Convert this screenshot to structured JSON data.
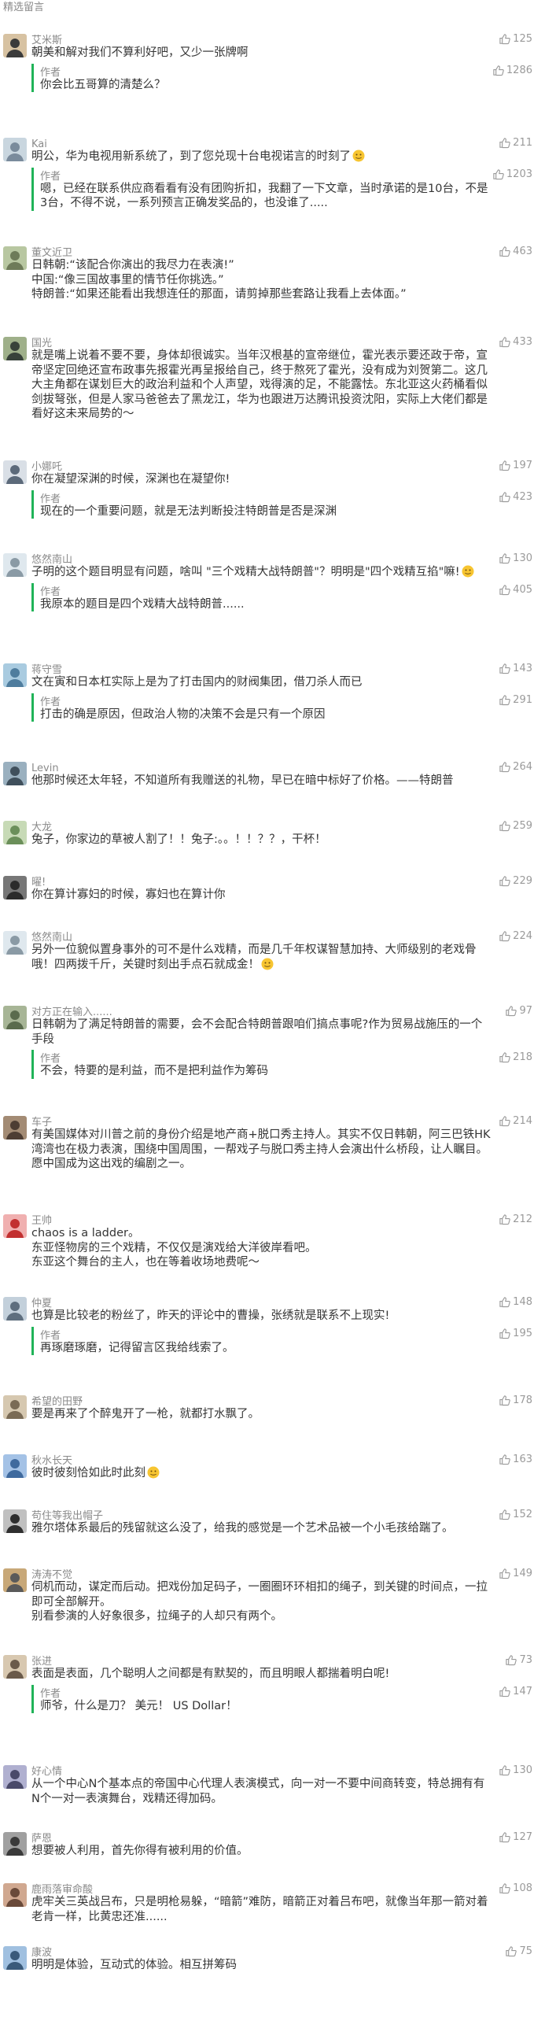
{
  "section_title": "精选留言",
  "author_label": "作者",
  "colors": {
    "accent": "#20b358",
    "meta": "#8a8a8a",
    "text": "#353535"
  },
  "comments": [
    {
      "nick": "艾米斯",
      "likes": "125",
      "text": "朝美和解对我们不算利好吧，又少一张牌啊",
      "reply": {
        "likes": "1286",
        "text": "你会比五哥算的清楚么？"
      }
    },
    {
      "nick": "Kai",
      "likes": "211",
      "text": "明公，华为电视用新系统了，到了您兑现十台电视诺言的时刻了",
      "reply": {
        "likes": "1203",
        "text": "嗯，已经在联系供应商看看有没有团购折扣，我翻了一下文章，当时承诺的是10台，不是3台，不得不说，一系列预言正确发奖品的，也没谁了....."
      }
    },
    {
      "nick": "董文近卫",
      "likes": "463",
      "text": "日韩朝:“该配合你演出的我尽力在表演!”\n中国:“像三国故事里的情节任你挑选。”\n特朗普:“如果还能看出我想连任的那面，请剪掉那些套路让我看上去体面。”"
    },
    {
      "nick": "国光",
      "likes": "433",
      "text": "就是嘴上说着不要不要，身体却很诚实。当年汉根基的宣帝继位，霍光表示要还政于帝，宣帝坚定回绝还宣布政事先报霍光再呈报给自己，终于熬死了霍光，没有成为刘贺第二。这几大主角都在谋划巨大的政治利益和个人声望，戏得演的足，不能露怯。东北亚这火药桶看似剑拔弩张，但是人家马爸爸去了黑龙江，华为也跟进万达腾讯投资沈阳，实际上大佬们都是看好这未来局势的～"
    },
    {
      "nick": "小娜吒",
      "likes": "197",
      "text": "你在凝望深渊的时候，深渊也在凝望你!",
      "reply": {
        "likes": "423",
        "text": "现在的一个重要问题，就是无法判断投注特朗普是否是深渊"
      }
    },
    {
      "nick": "悠然南山",
      "likes": "130",
      "text": "子明的这个题目明显有问题，啥叫 \"三个戏精大战特朗普\"？明明是\"四个戏精互掐\"嘛!",
      "reply": {
        "likes": "405",
        "text": "我原本的题目是四个戏精大战特朗普......"
      }
    },
    {
      "nick": "蒋守雪",
      "likes": "143",
      "text": "文在寅和日本杠实际上是为了打击国内的财阀集团，借刀杀人而已",
      "reply": {
        "likes": "291",
        "text": "打击的确是原因，但政治人物的决策不会是只有一个原因"
      }
    },
    {
      "nick": "Levin",
      "likes": "264",
      "text": "他那时候还太年轻，不知道所有我赠送的礼物，早已在暗中标好了价格。——特朗普"
    },
    {
      "nick": "大龙",
      "likes": "259",
      "text": "兔子，你家边的草被人割了！！兔子:。。！！？？，干杯！"
    },
    {
      "nick": "曜!",
      "likes": "229",
      "text": "你在算计寡妇的时候，寡妇也在算计你"
    },
    {
      "nick": "悠然南山",
      "likes": "224",
      "text": "另外一位貌似置身事外的可不是什么戏精，而是几千年权谋智慧加持、大师级别的老戏骨哦！四两拨千斤，关键时刻出手点石就成金！"
    },
    {
      "nick": "对方正在输入......",
      "likes": "97",
      "text": "日韩朝为了满足特朗普的需要，会不会配合特朗普跟咱们搞点事呢?作为贸易战施压的一个手段",
      "reply": {
        "likes": "218",
        "text": "不会，特要的是利益，而不是把利益作为筹码"
      }
    },
    {
      "nick": "车子",
      "likes": "214",
      "text": "有美国媒体对川普之前的身份介绍是地产商+脱口秀主持人。其实不仅日韩朝，阿三巴铁HK湾湾也在极力表演，围绕中国周围，一帮戏子与脱口秀主持人会演出什么桥段，让人瞩目。愿中国成为这出戏的编剧之一。"
    },
    {
      "nick": "王帅",
      "likes": "212",
      "text": "chaos is a ladder。\n东亚怪物房的三个戏精，不仅仅是演戏给大洋彼岸看吧。\n东亚这个舞台的主人，也在等着收场地费呢～"
    },
    {
      "nick": "仲夏",
      "likes": "148",
      "text": "也算是比较老的粉丝了，昨天的评论中的曹操，张绣就是联系不上现实!",
      "reply": {
        "likes": "195",
        "text": "再琢磨琢磨，记得留言区我给线索了。"
      }
    },
    {
      "nick": "希望的田野",
      "likes": "178",
      "text": "要是再来了个醉鬼开了一枪，就都打水飘了。"
    },
    {
      "nick": "秋水长天",
      "likes": "163",
      "text": "彼时彼刻恰如此时此刻"
    },
    {
      "nick": "苟住等我出帽子",
      "likes": "152",
      "text": "雅尔塔体系最后的残留就这么没了，给我的感觉是一个艺术品被一个小毛孩给踹了。"
    },
    {
      "nick": "涛涛不觉",
      "likes": "149",
      "text": "伺机而动，谋定而后动。把戏份加足码子，一圈圈环环相扣的绳子，到关键的时间点，一拉即可全部解开。\n别看参演的人好象很多，拉绳子的人却只有两个。"
    },
    {
      "nick": "张进",
      "likes": "73",
      "text": "表面是表面，几个聪明人之间都是有默契的，而且明眼人都揣着明白呢!",
      "reply": {
        "likes": "147",
        "text": "师爷，什么是刀？ 美元！ US Dollar！"
      }
    },
    {
      "nick": "好心情",
      "likes": "130",
      "text": "从一个中心N个基本点的帝国中心代理人表演模式，向一对一不要中间商转变，特总拥有有N个一对一表演舞台，戏精还得加码。"
    },
    {
      "nick": "萨恩",
      "likes": "127",
      "text": "想要被人利用，首先你得有被利用的价值。"
    },
    {
      "nick": "鹿雨落审命酸",
      "likes": "108",
      "text": "虎牢关三英战吕布，只是明枪易躲，“暗箭”难防，暗箭正对着吕布吧，就像当年那一箭对着老肯一样，比黄忠还准......"
    },
    {
      "nick": "康波",
      "likes": "75",
      "text": "明明是体验，互动式的体验。相互拼筹码"
    }
  ]
}
